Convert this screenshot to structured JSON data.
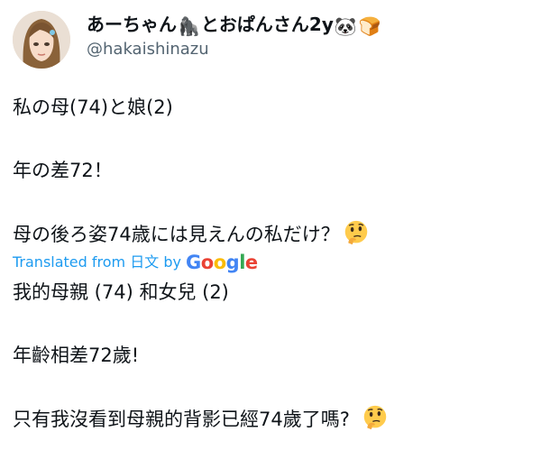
{
  "profile": {
    "display_name": "あーちゃん🦍とおぱんさん2y🐼🍞",
    "name_text": "あーちゃん",
    "name_text_2": "とおぱんさん2y",
    "emoji_1": "🦍",
    "emoji_2": "🐼",
    "emoji_3": "🍞",
    "handle": "@hakaishinazu"
  },
  "tweet": {
    "original": [
      "私の母(74)と娘(2)",
      "年の差72！",
      "母の後ろ姿74歳には見えんの私だけ？"
    ],
    "translation_label": "Translated from",
    "translation_language": "日文",
    "translation_by": "by",
    "translation_provider": "Google",
    "translated": [
      "我的母親 (74) 和女兒 (2)",
      "年齡相差72歲!",
      "只有我沒看到母親的背影已經74歲了嗎?"
    ]
  },
  "icons": {
    "thinking_face": "thinking-face-icon"
  },
  "colors": {
    "text": "#0f1419",
    "handle": "#536471",
    "link": "#1d9bf0",
    "google_blue": "#4285f4",
    "google_red": "#ea4335",
    "google_yellow": "#fbbc05",
    "google_green": "#34a853"
  }
}
